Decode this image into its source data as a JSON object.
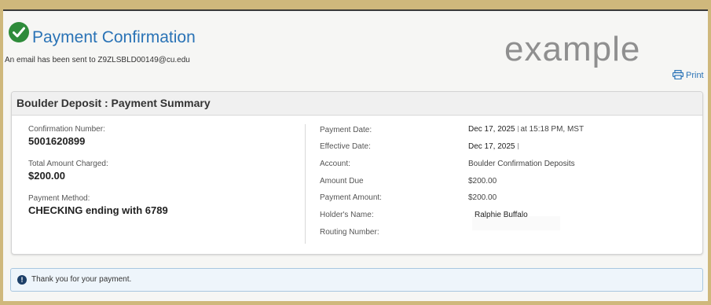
{
  "header": {
    "title": "Payment Confirmation",
    "email_notice": "An email has been sent to Z9ZLSBLD00149@cu.edu",
    "watermark": "example",
    "print_label": "Print"
  },
  "summary": {
    "title": "Boulder Deposit : Payment Summary",
    "left": {
      "confirmation_label": "Confirmation Number:",
      "confirmation_value": "5001620899",
      "total_label": "Total Amount Charged:",
      "total_value": "$200.00",
      "method_label": "Payment Method:",
      "method_value": "CHECKING ending with 6789"
    },
    "right": {
      "payment_date_label": "Payment Date:",
      "payment_date_value": "Dec 17, 2025",
      "payment_time_value": "at 15:18 PM, MST",
      "effective_date_label": "Effective Date:",
      "effective_date_value": "Dec 17, 2025",
      "account_label": "Account:",
      "account_value": "Boulder Confirmation Deposits",
      "amount_due_label": "Amount Due",
      "amount_due_value": "$200.00",
      "payment_amount_label": "Payment Amount:",
      "payment_amount_value": "$200.00",
      "holder_label": "Holder's Name:",
      "holder_value": "Ralphie Buffalo",
      "routing_label": "Routing Number:"
    }
  },
  "thanks": {
    "text": "Thank you for your payment."
  },
  "colors": {
    "accent_gold": "#cfb87c",
    "link_blue": "#2a73b6",
    "success_green": "#2e8b3a"
  }
}
